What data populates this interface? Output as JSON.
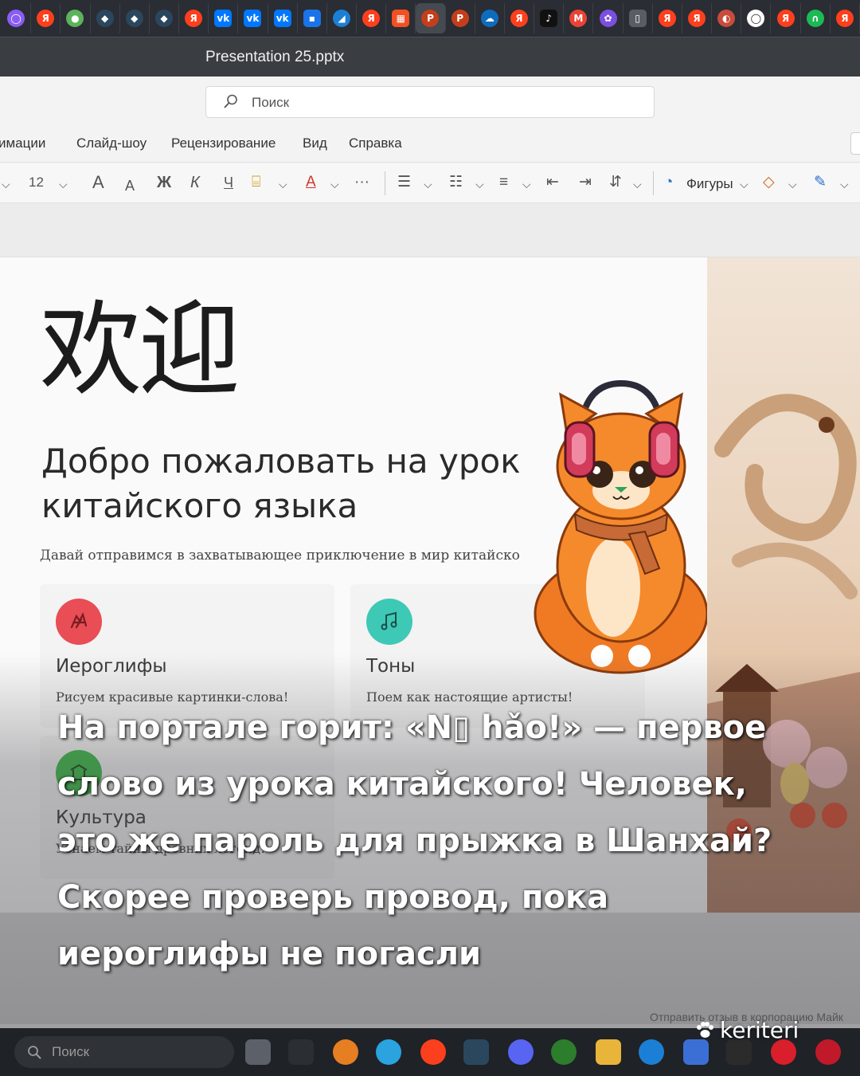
{
  "browser": {
    "tabs": [
      {
        "icon": "alice-icon",
        "glyph": "◯",
        "color": "#8a5cf5"
      },
      {
        "icon": "yandex-icon",
        "glyph": "Я",
        "color": "#fc3f1d"
      },
      {
        "icon": "browser-globe-icon",
        "glyph": "●",
        "color": "#5bb35b"
      },
      {
        "icon": "steam-icon",
        "glyph": "◆",
        "color": "#2a475e"
      },
      {
        "icon": "steam-icon",
        "glyph": "◆",
        "color": "#2a475e"
      },
      {
        "icon": "steam-icon",
        "glyph": "◆",
        "color": "#2a475e"
      },
      {
        "icon": "yandex-icon",
        "glyph": "Я",
        "color": "#fc3f1d"
      },
      {
        "icon": "vk-icon",
        "glyph": "vk",
        "color": "#0077ff"
      },
      {
        "icon": "vk-icon",
        "glyph": "vk",
        "color": "#0077ff"
      },
      {
        "icon": "vk-icon",
        "glyph": "vk",
        "color": "#0077ff"
      },
      {
        "icon": "messenger-icon",
        "glyph": "▪",
        "color": "#1a73e8"
      },
      {
        "icon": "edge-icon",
        "glyph": "◢",
        "color": "#1b7fd6"
      },
      {
        "icon": "yandex-icon",
        "glyph": "Я",
        "color": "#fc3f1d"
      },
      {
        "icon": "microsoft-icon",
        "glyph": "▦",
        "color": "#f25022"
      },
      {
        "icon": "powerpoint-icon",
        "glyph": "P",
        "color": "#c43e1c"
      },
      {
        "icon": "powerpoint-icon",
        "glyph": "P",
        "color": "#c43e1c"
      },
      {
        "icon": "onedrive-icon",
        "glyph": "☁",
        "color": "#0f6cbd"
      },
      {
        "icon": "yandex-icon",
        "glyph": "Я",
        "color": "#fc3f1d"
      },
      {
        "icon": "tiktok-icon",
        "glyph": "♪",
        "color": "#111111"
      },
      {
        "icon": "gmail-icon",
        "glyph": "M",
        "color": "#ea4335"
      },
      {
        "icon": "copilot-icon",
        "glyph": "✿",
        "color": "#7b4fe0"
      },
      {
        "icon": "document-icon",
        "glyph": "▯",
        "color": "#5a5d63"
      },
      {
        "icon": "yandex-icon",
        "glyph": "Я",
        "color": "#fc3f1d"
      },
      {
        "icon": "yandex-icon",
        "glyph": "Я",
        "color": "#fc3f1d"
      },
      {
        "icon": "game-icon",
        "glyph": "◐",
        "color": "#c94b3b"
      },
      {
        "icon": "alice-icon",
        "glyph": "◯",
        "color": "#ffffff"
      },
      {
        "icon": "yandex-icon",
        "glyph": "Я",
        "color": "#fc3f1d"
      },
      {
        "icon": "headphones-icon",
        "glyph": "∩",
        "color": "#1db954"
      },
      {
        "icon": "yandex-icon",
        "glyph": "Я",
        "color": "#fc3f1d"
      }
    ],
    "active_tab_index": 14
  },
  "window": {
    "title": "Presentation 25.pptx"
  },
  "search": {
    "placeholder": "Поиск"
  },
  "menu": {
    "items": [
      "имации",
      "Слайд-шоу",
      "Рецензирование",
      "Вид",
      "Справка"
    ]
  },
  "toolbar": {
    "font_size": "12",
    "grow_font": "A",
    "shrink_font": "A",
    "bold": "Ж",
    "italic": "К",
    "underline": "Ч",
    "font_color": "A",
    "more": "···",
    "shapes_label": "Фигуры"
  },
  "slide": {
    "hanzi": "欢迎",
    "heading_line1": "Добро пожаловать на урок",
    "heading_line2": "китайского языка",
    "subtitle": "Давай отправимся в захватывающее приключение в мир китайско",
    "cards": [
      {
        "title": "Иероглифы",
        "desc": "Рисуем красивые картинки-слова!",
        "icon": "dragon-icon",
        "color": "#e94d55"
      },
      {
        "title": "Тоны",
        "desc": "Поем как настоящие артисты!",
        "icon": "music-note-icon",
        "color": "#3ec9b7"
      },
      {
        "title": "Культура",
        "desc": "Узнаем тайны древних легенд!",
        "icon": "culture-icon",
        "color": "#3fba4a"
      }
    ]
  },
  "status": {
    "feedback": "Отправить отзыв в корпорацию Майк"
  },
  "caption": {
    "lines": [
      "На портале горит: «N▯ hǎo!» — первое",
      "слово из урока китайского! Человек,",
      "это же пароль для прыжка в Шанхай?",
      "Скорее проверь провод, пока",
      "иероглифы не погасли"
    ]
  },
  "taskbar": {
    "search_placeholder": "Поиск",
    "apps": [
      {
        "icon": "task-view-icon",
        "color": "#5c6068"
      },
      {
        "icon": "terminal-icon",
        "color": "#2b2e33"
      },
      {
        "icon": "app-orange-icon",
        "color": "#e67e22"
      },
      {
        "icon": "telegram-icon",
        "color": "#2aa3df"
      },
      {
        "icon": "yandex-browser-icon",
        "color": "#fc3f1d"
      },
      {
        "icon": "steam-icon",
        "color": "#2a475e"
      },
      {
        "icon": "discord-icon",
        "color": "#5865f2"
      },
      {
        "icon": "xbox-icon",
        "color": "#2c7d2c"
      },
      {
        "icon": "file-explorer-icon",
        "color": "#e8b43a"
      },
      {
        "icon": "edge-icon",
        "color": "#1b7fd6"
      },
      {
        "icon": "store-icon",
        "color": "#3b6fd6"
      },
      {
        "icon": "epic-games-icon",
        "color": "#2b2b2b"
      },
      {
        "icon": "opera-icon",
        "color": "#d91f2c"
      },
      {
        "icon": "opera-gx-icon",
        "color": "#c01a2a"
      }
    ]
  },
  "watermark": {
    "text": "keriteri"
  }
}
